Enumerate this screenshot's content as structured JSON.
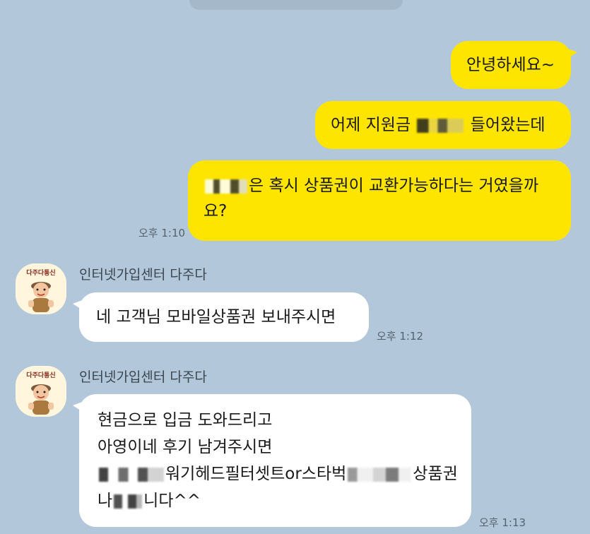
{
  "colors": {
    "background": "#b2c7da",
    "my_bubble": "#fee500",
    "their_bubble": "#ffffff",
    "timestamp": "#56626d"
  },
  "messages": {
    "m1": {
      "text": "안녕하세요~"
    },
    "m2": {
      "prefix": "어제 지원금",
      "suffix": "들어왔는데"
    },
    "m3": {
      "part1": "은 혹시 상품권이 교환가능하다는 거였을까",
      "part2": "요?"
    },
    "time_out": "오후 1:10",
    "sender_name": "인터넷가입센터 다주다",
    "avatar_logo_text": "다주다통신",
    "r1": {
      "text": "네 고객님 모바일상품권 보내주시면",
      "time": "오후 1:12"
    },
    "r2": {
      "line1": "현금으로 입금 도와드리고",
      "line2": "아영이네 후기 남겨주시면",
      "line3a": "워기헤드필터셋트or스타벅",
      "line3b": "상품권",
      "line4a": "나",
      "line4b": "니다^^",
      "time": "오후 1:13"
    }
  }
}
